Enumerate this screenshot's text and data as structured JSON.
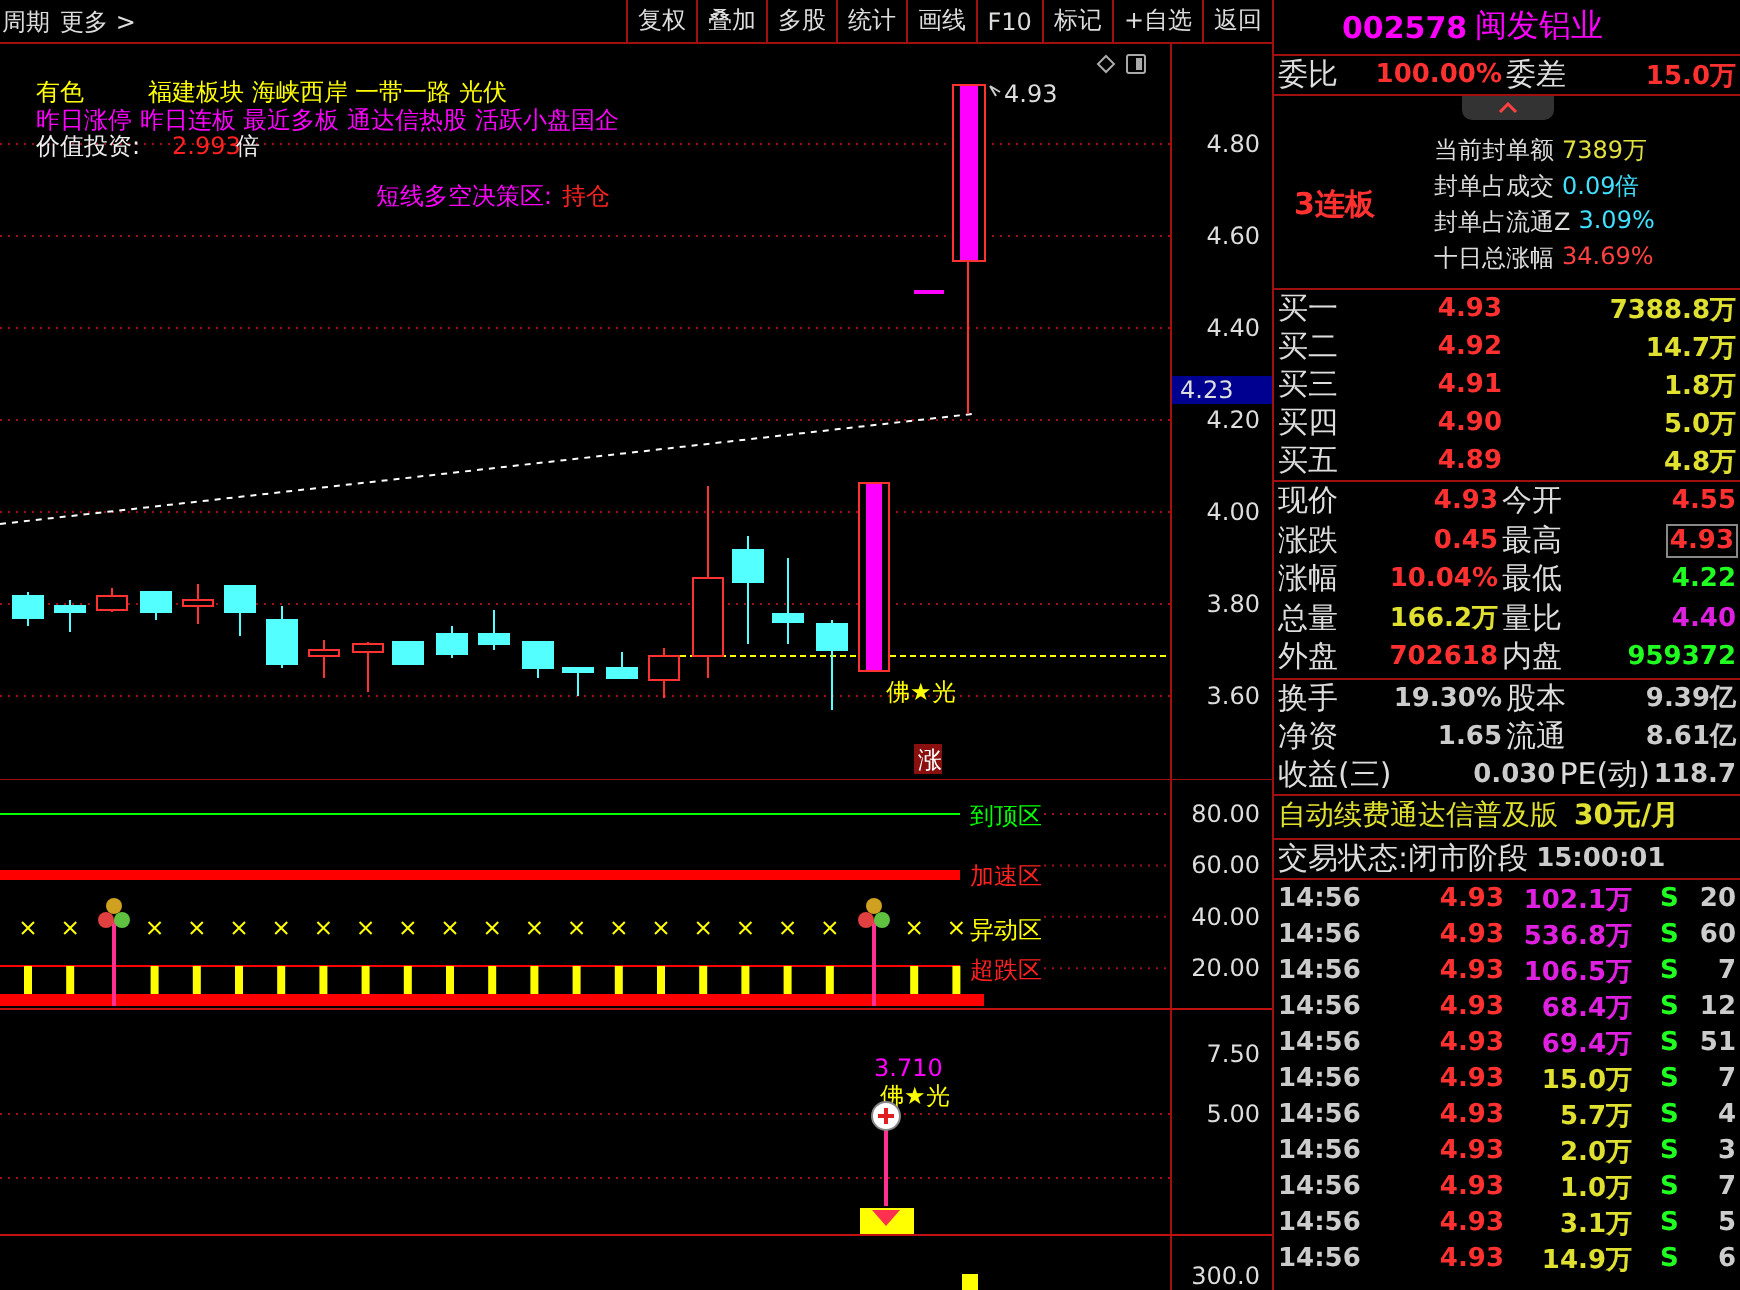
{
  "toolbar": {
    "left": [
      "周期",
      "更多 >"
    ],
    "buttons": [
      "复权",
      "叠加",
      "多股",
      "统计",
      "画线",
      "F10",
      "标记",
      "+自选",
      "返回"
    ]
  },
  "main_chart": {
    "tags": [
      {
        "text": "有色",
        "color": "#ffff00"
      },
      {
        "text": "福建板块  海峡西岸 一带一路 光伏",
        "color": "#ffff00"
      }
    ],
    "hot_tags": "昨日涨停 昨日连板 最近多板 通达信热股 活跃小盘国企",
    "value_label": "价值投资:",
    "value": "2.993",
    "value_unit": "倍",
    "decision_label": "短线多空决策区:",
    "decision_value": "持仓",
    "high_label": "4.93",
    "signal_label": "佛★光",
    "limit_badge": "涨",
    "y_ticks": [
      "4.80",
      "4.60",
      "4.40",
      "4.20",
      "4.00",
      "3.80",
      "3.60"
    ],
    "current_price": "4.23"
  },
  "zone_chart": {
    "y_ticks": [
      "80.00",
      "60.00",
      "40.00",
      "20.00"
    ],
    "zones": [
      {
        "label": "到顶区",
        "color": "#00ff00"
      },
      {
        "label": "加速区",
        "color": "#ff2020"
      },
      {
        "label": "异动区",
        "color": "#ffff00"
      },
      {
        "label": "超跌区",
        "color": "#ff2020"
      }
    ]
  },
  "signal_chart": {
    "y_ticks": [
      "7.50",
      "5.00"
    ],
    "value_label": "3.710",
    "signal_label": "佛★光",
    "lower_tick": "300.0"
  },
  "stock": {
    "code": "002578",
    "name": "闽发铝业"
  },
  "order_ratio": {
    "label": "委比",
    "value": "100.00%",
    "label2": "委差",
    "value2": "15.0万"
  },
  "limit_up": {
    "streak": "3连板",
    "stats": [
      {
        "label": "当前封单额",
        "value": "7389万",
        "color": "#e0e040"
      },
      {
        "label": "封单占成交",
        "value": "0.09倍",
        "color": "#40e0ff"
      },
      {
        "label": "封单占流通Z",
        "value": "3.09%",
        "color": "#40e0ff"
      },
      {
        "label": "十日总涨幅",
        "value": "34.69%",
        "color": "#ff4040"
      }
    ]
  },
  "bids": [
    {
      "label": "买一",
      "price": "4.93",
      "volume": "7388.8万"
    },
    {
      "label": "买二",
      "price": "4.92",
      "volume": "14.7万"
    },
    {
      "label": "买三",
      "price": "4.91",
      "volume": "1.8万"
    },
    {
      "label": "买四",
      "price": "4.90",
      "volume": "5.0万"
    },
    {
      "label": "买五",
      "price": "4.89",
      "volume": "4.8万"
    }
  ],
  "quote": [
    {
      "label": "现价",
      "value": "4.93",
      "color": "#ff3030",
      "boxed": false
    },
    {
      "label": "今开",
      "value": "4.55",
      "color": "#ff3030",
      "boxed": false
    },
    {
      "label": "涨跌",
      "value": "0.45",
      "color": "#ff3030",
      "boxed": false
    },
    {
      "label": "最高",
      "value": "4.93",
      "color": "#ff3030",
      "boxed": true
    },
    {
      "label": "涨幅",
      "value": "10.04%",
      "color": "#ff3030",
      "boxed": false
    },
    {
      "label": "最低",
      "value": "4.22",
      "color": "#20ff20",
      "boxed": false
    },
    {
      "label": "总量",
      "value": "166.2万",
      "color": "#e0e030",
      "boxed": false
    },
    {
      "label": "量比",
      "value": "4.40",
      "color": "#e020e0",
      "boxed": false
    },
    {
      "label": "外盘",
      "value": "702618",
      "color": "#ff3030",
      "boxed": false
    },
    {
      "label": "内盘",
      "value": "959372",
      "color": "#20ff20",
      "boxed": false
    }
  ],
  "fundamentals": [
    {
      "label": "换手",
      "value": "19.30%",
      "label2": "股本",
      "value2": "9.39亿"
    },
    {
      "label": "净资",
      "value": "1.65",
      "label2": "流通",
      "value2": "8.61亿"
    },
    {
      "label": "收益(三)",
      "value": "0.030",
      "label2": "PE(动)",
      "value2": "118.7"
    }
  ],
  "promo": {
    "text": "自动续费通达信普及版",
    "price": "30元/月"
  },
  "status": {
    "label": "交易状态:",
    "phase": "闭市阶段",
    "time": "15:00:01"
  },
  "trades": [
    {
      "time": "14:56",
      "price": "4.93",
      "volume": "102.1万",
      "big": true,
      "side": "S",
      "count": "20"
    },
    {
      "time": "14:56",
      "price": "4.93",
      "volume": "536.8万",
      "big": true,
      "side": "S",
      "count": "60"
    },
    {
      "time": "14:56",
      "price": "4.93",
      "volume": "106.5万",
      "big": true,
      "side": "S",
      "count": "7"
    },
    {
      "time": "14:56",
      "price": "4.93",
      "volume": "68.4万",
      "big": true,
      "side": "S",
      "count": "12"
    },
    {
      "time": "14:56",
      "price": "4.93",
      "volume": "69.4万",
      "big": true,
      "side": "S",
      "count": "51"
    },
    {
      "time": "14:56",
      "price": "4.93",
      "volume": "15.0万",
      "big": false,
      "side": "S",
      "count": "7"
    },
    {
      "time": "14:56",
      "price": "4.93",
      "volume": "5.7万",
      "big": false,
      "side": "S",
      "count": "4"
    },
    {
      "time": "14:56",
      "price": "4.93",
      "volume": "2.0万",
      "big": false,
      "side": "S",
      "count": "3"
    },
    {
      "time": "14:56",
      "price": "4.93",
      "volume": "1.0万",
      "big": false,
      "side": "S",
      "count": "7"
    },
    {
      "time": "14:56",
      "price": "4.93",
      "volume": "3.1万",
      "big": false,
      "side": "S",
      "count": "5"
    },
    {
      "time": "14:56",
      "price": "4.93",
      "volume": "14.9万",
      "big": false,
      "side": "S",
      "count": "6"
    }
  ]
}
